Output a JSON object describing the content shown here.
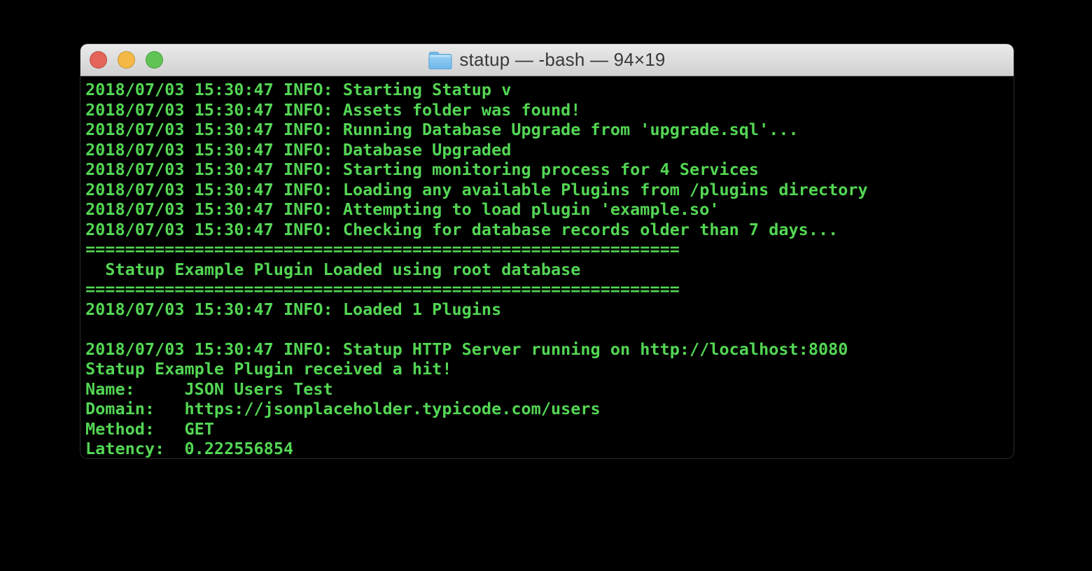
{
  "window": {
    "title": "statup — -bash — 94×19",
    "traffic_lights": {
      "close_color": "#e4645a",
      "minimize_color": "#f3b845",
      "zoom_color": "#5fc454"
    },
    "folder_icon": {
      "name": "blue-folder-icon",
      "fill_top": "#9bd4f5",
      "fill_bottom": "#6fb7ea",
      "stroke": "#59a2d6"
    }
  },
  "terminal": {
    "text_color": "#53d653",
    "background_color": "#000000",
    "lines": [
      "2018/07/03 15:30:47 INFO: Starting Statup v",
      "2018/07/03 15:30:47 INFO: Assets folder was found!",
      "2018/07/03 15:30:47 INFO: Running Database Upgrade from 'upgrade.sql'...",
      "2018/07/03 15:30:47 INFO: Database Upgraded",
      "2018/07/03 15:30:47 INFO: Starting monitoring process for 4 Services",
      "2018/07/03 15:30:47 INFO: Loading any available Plugins from /plugins directory",
      "2018/07/03 15:30:47 INFO: Attempting to load plugin 'example.so'",
      "2018/07/03 15:30:47 INFO: Checking for database records older than 7 days...",
      "============================================================",
      "  Statup Example Plugin Loaded using root database",
      "============================================================",
      "2018/07/03 15:30:47 INFO: Loaded 1 Plugins",
      "",
      "2018/07/03 15:30:47 INFO: Statup HTTP Server running on http://localhost:8080",
      "Statup Example Plugin received a hit!",
      "Name:     JSON Users Test",
      "Domain:   https://jsonplaceholder.typicode.com/users",
      "Method:   GET",
      "Latency:  0.222556854"
    ]
  }
}
